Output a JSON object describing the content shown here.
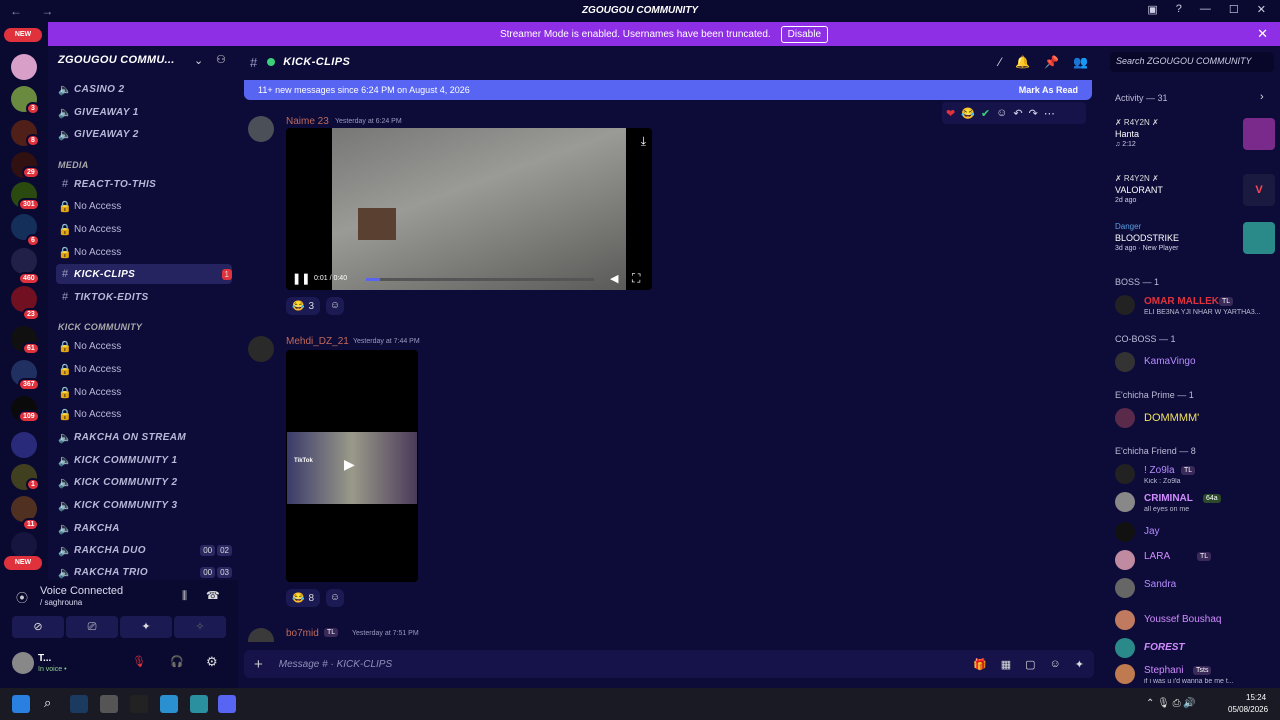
{
  "titlebar": {
    "title": "ZGOUGOU COMMUNITY"
  },
  "banner": {
    "text": "Streamer Mode is enabled. Usernames have been truncated.",
    "button": "Disable"
  },
  "rail": {
    "new_top": "NEW",
    "new_bottom": "NEW",
    "badges": [
      "3",
      "8",
      "29",
      "301",
      "6",
      "460",
      "23",
      "61",
      "367",
      "109",
      "1",
      "11"
    ]
  },
  "server": {
    "name": "ZGOUGOU COMMU..."
  },
  "channels": [
    {
      "name": "CASINO 2"
    },
    {
      "name": "GIVEAWAY 1"
    },
    {
      "name": "GIVEAWAY 2"
    },
    {
      "category": "MEDIA"
    },
    {
      "name": "REACT-TO-THIS"
    },
    {
      "name": "No Access"
    },
    {
      "name": "No Access"
    },
    {
      "name": "No Access"
    },
    {
      "name": "KICK-CLIPS",
      "badge": "1"
    },
    {
      "name": "TIKTOK-EDITS"
    },
    {
      "category": "KICK COMMUNITY"
    },
    {
      "name": "No Access"
    },
    {
      "name": "No Access"
    },
    {
      "name": "No Access"
    },
    {
      "name": "No Access"
    },
    {
      "name": "RAKCHA ON STREAM"
    },
    {
      "name": "KICK COMMUNITY 1"
    },
    {
      "name": "KICK COMMUNITY 2"
    },
    {
      "name": "KICK COMMUNITY 3"
    },
    {
      "name": "RAKCHA"
    },
    {
      "name": "RAKCHA DUO",
      "c1": "00",
      "c2": "02"
    },
    {
      "name": "RAKCHA TRIO",
      "c1": "00",
      "c2": "03"
    }
  ],
  "voice": {
    "status": "Voice Connected",
    "sub": "/ saghrouna"
  },
  "user": {
    "name": "T...",
    "status": "In voice •"
  },
  "chat": {
    "channel": "KICK-CLIPS",
    "search": "Search ZGOUGOU COMMUNITY",
    "placeholder": "Message # · KICK-CLIPS"
  },
  "newbar": {
    "text": "11+ new messages since 6:24 PM on August 4, 2026",
    "mark": "Mark As Read"
  },
  "messages": [
    {
      "author": "Naime 23",
      "time": "Yesterday at 6:24 PM",
      "video_time": "0:01 / 0:40",
      "reaction_count": "3"
    },
    {
      "author": "Mehdi_DZ_21",
      "time": "Yesterday at 7:44 PM",
      "reaction_count": "8",
      "overlay": "TikTok"
    },
    {
      "author": "bo7mid",
      "tag": "TL",
      "time": "Yesterday at 7:51 PM"
    }
  ],
  "members": {
    "activity_header": "Activity — 31",
    "activities": [
      {
        "name": "✗ R4Y2N ✗",
        "game": "Hanta",
        "detail": "♫ 2:12"
      },
      {
        "name": "✗ R4Y2N ✗",
        "game": "VALORANT",
        "detail": "2d ago"
      },
      {
        "name": "Danger",
        "game": "BLOODSTRIKE",
        "detail": "3d ago  ·  New Player"
      }
    ],
    "groups": [
      {
        "label": "BOSS — 1",
        "members": [
          {
            "name": "OMAR MALLEK",
            "tag": "TL",
            "status": "ELI BE3NA YJI NHAR W YARTHA3..."
          }
        ]
      },
      {
        "label": "CO-BOSS — 1",
        "members": [
          {
            "name": "KamaVingo",
            "status": ""
          }
        ]
      },
      {
        "label": "E'chicha Prime — 1",
        "members": [
          {
            "name": "DOMMMM'",
            "status": ""
          }
        ]
      },
      {
        "label": "E'chicha Friend — 8",
        "members": [
          {
            "name": "! Zo9la",
            "tag": "TL",
            "status": "Kick : Zo9la"
          },
          {
            "name": "CRIMINAL",
            "tag": "64a",
            "status": "all eyes on me"
          },
          {
            "name": "Jay",
            "status": ""
          },
          {
            "name": "LARA",
            "tag": "TL",
            "status": ""
          },
          {
            "name": "Sandra",
            "status": ""
          },
          {
            "name": "Youssef Boushaq",
            "status": ""
          },
          {
            "name": "FOREST",
            "status": ""
          },
          {
            "name": "Stephani",
            "tag": "Tsts",
            "status": "if i was u i'd wanna be me t..."
          }
        ]
      }
    ]
  },
  "taskbar": {
    "time": "15:24",
    "date": "05/08/2026"
  },
  "colors": {
    "bg": "#0d0b38",
    "banner": "#8e2fe6",
    "accent": "#5865f2",
    "boss": "#e0323c",
    "member": "#b68cff"
  }
}
